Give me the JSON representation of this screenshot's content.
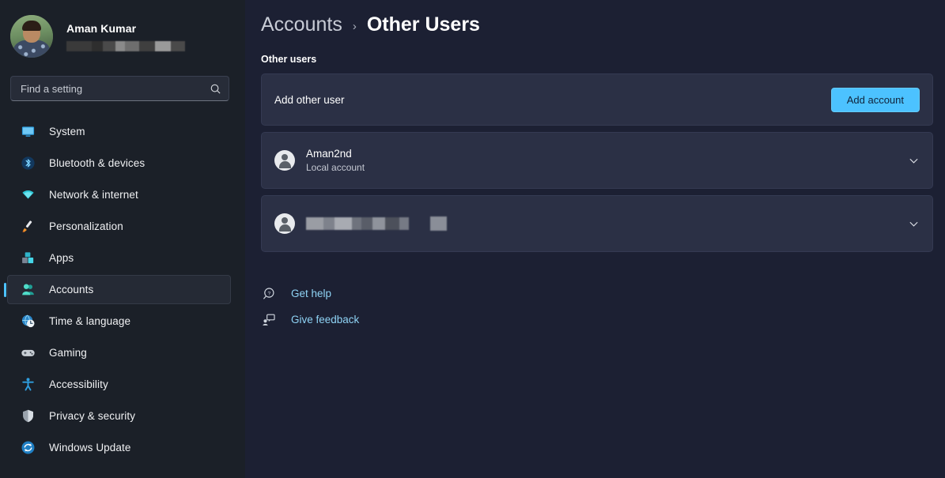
{
  "sidebar": {
    "profile": {
      "name": "Aman Kumar",
      "email_redacted": true,
      "avatar": "user-photo-avatar"
    },
    "search": {
      "placeholder": "Find a setting",
      "value": "",
      "icon": "search-icon"
    },
    "items": [
      {
        "label": "System",
        "icon": "monitor-icon",
        "selected": false
      },
      {
        "label": "Bluetooth & devices",
        "icon": "bluetooth-icon",
        "selected": false
      },
      {
        "label": "Network & internet",
        "icon": "wifi-icon",
        "selected": false
      },
      {
        "label": "Personalization",
        "icon": "paintbrush-icon",
        "selected": false
      },
      {
        "label": "Apps",
        "icon": "apps-grid-icon",
        "selected": false
      },
      {
        "label": "Accounts",
        "icon": "people-icon",
        "selected": true
      },
      {
        "label": "Time & language",
        "icon": "clock-globe-icon",
        "selected": false
      },
      {
        "label": "Gaming",
        "icon": "gamepad-icon",
        "selected": false
      },
      {
        "label": "Accessibility",
        "icon": "accessibility-icon",
        "selected": false
      },
      {
        "label": "Privacy & security",
        "icon": "shield-icon",
        "selected": false
      },
      {
        "label": "Windows Update",
        "icon": "update-refresh-icon",
        "selected": false
      }
    ]
  },
  "main": {
    "breadcrumb": {
      "parent": "Accounts",
      "separator": "›",
      "current": "Other Users"
    },
    "section_label": "Other users",
    "add_user": {
      "label": "Add other user",
      "button": "Add account"
    },
    "users": [
      {
        "name": "Aman2nd",
        "subtitle": "Local account",
        "redacted": false,
        "expander": "chevron-down-icon"
      },
      {
        "name": "",
        "subtitle": "",
        "redacted": true,
        "expander": "chevron-down-icon"
      }
    ],
    "links": [
      {
        "label": "Get help",
        "icon": "help-question-icon"
      },
      {
        "label": "Give feedback",
        "icon": "feedback-person-icon"
      }
    ]
  },
  "colors": {
    "accent": "#4cc2ff",
    "link": "#8fd3f5",
    "page_bg": "#1c2033",
    "sidebar_bg": "#1b2028",
    "card_bg": "#2b3045"
  }
}
